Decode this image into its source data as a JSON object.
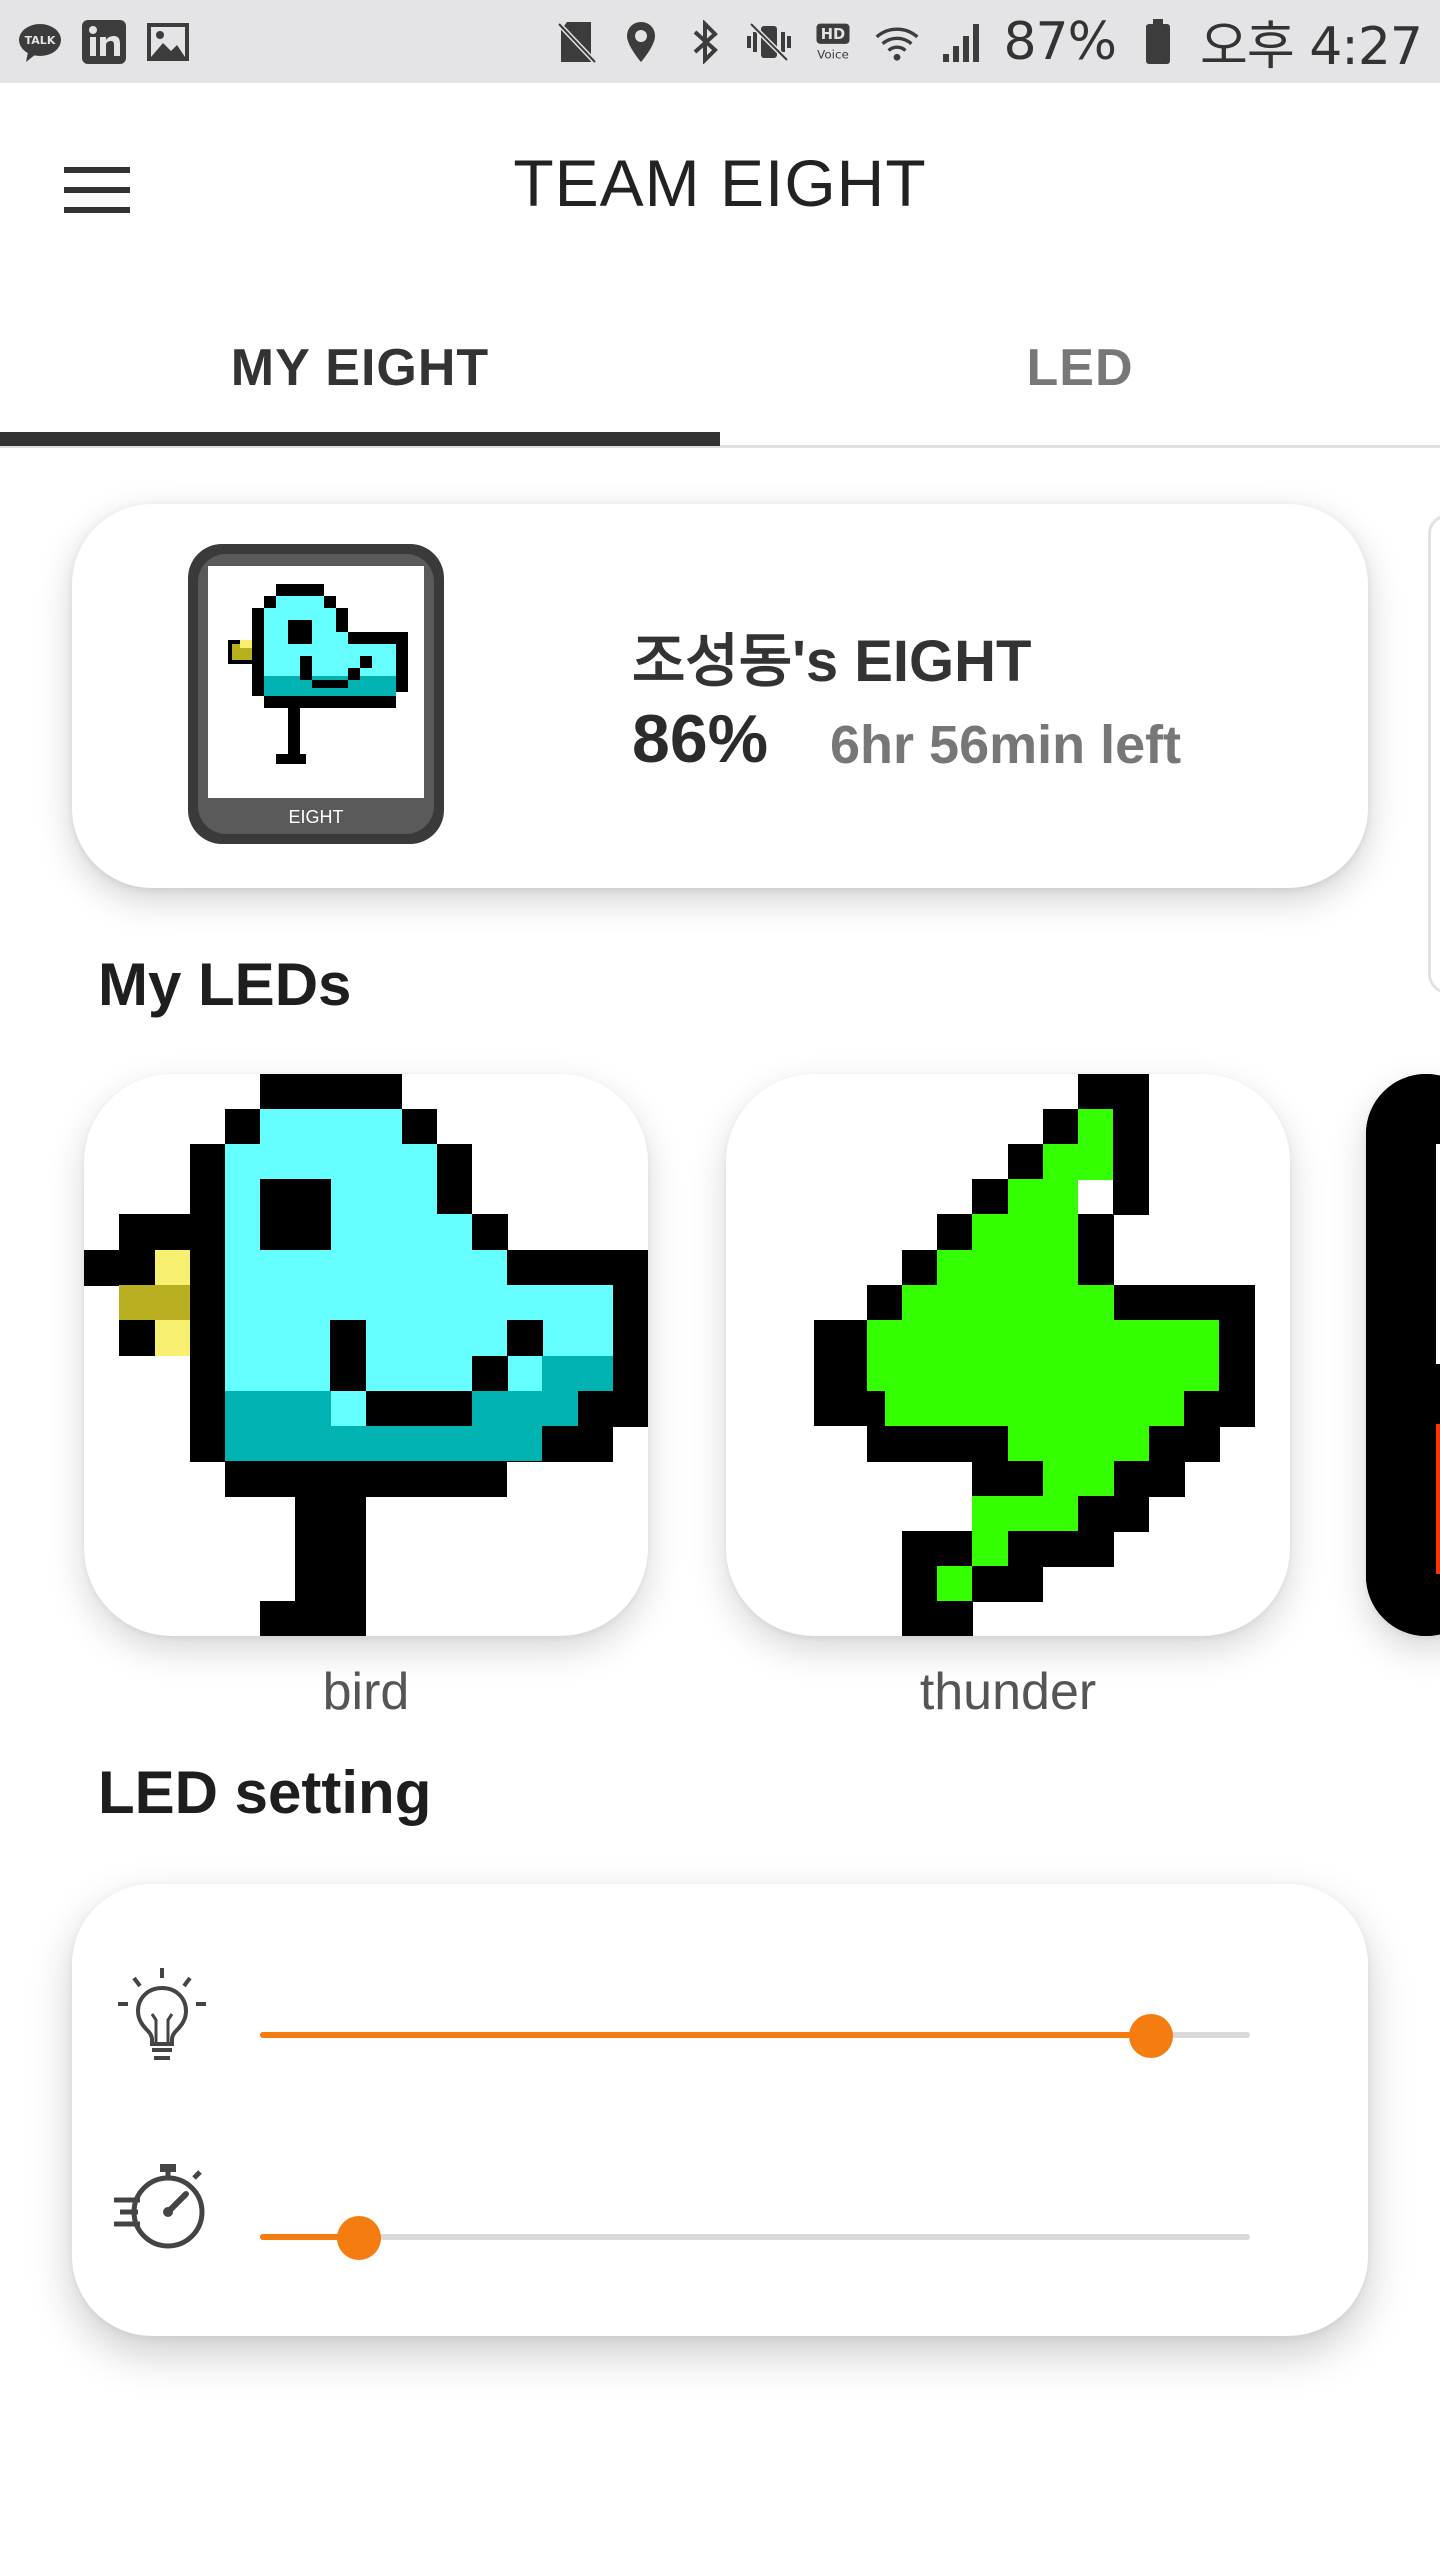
{
  "status_bar": {
    "left_icons": [
      "talk-icon",
      "linkedin-icon",
      "gallery-icon"
    ],
    "right_icons": [
      "sd-card-off-icon",
      "location-icon",
      "bluetooth-icon",
      "vibrate-icon",
      "hd-voice-icon",
      "wifi-icon",
      "signal-icon"
    ],
    "battery_percent": "87%",
    "time": "오후 4:27"
  },
  "app_bar": {
    "title": "TEAM EIGHT",
    "menu_icon": "hamburger-menu-icon"
  },
  "tabs": [
    {
      "label": "MY EIGHT",
      "selected": true
    },
    {
      "label": "LED",
      "selected": false
    }
  ],
  "device": {
    "name": "조성동's EIGHT",
    "battery": "86%",
    "time_left": "6hr 56min left",
    "thumb_label": "EIGHT"
  },
  "my_leds": {
    "title": "My LEDs",
    "items": [
      {
        "label": "bird"
      },
      {
        "label": "thunder"
      }
    ]
  },
  "led_setting": {
    "title": "LED setting",
    "brightness": {
      "icon": "lightbulb-icon",
      "value": 0.9
    },
    "speed": {
      "icon": "stopwatch-icon",
      "value": 0.1
    }
  },
  "colors": {
    "accent": "#f57c10",
    "bird_body": "#66ffff",
    "bird_shade": "#00b2b2",
    "bird_beak": "#b8b020",
    "bird_beak_light": "#f8f070",
    "thunder": "#33ff00",
    "third_led": "#ff3300"
  }
}
